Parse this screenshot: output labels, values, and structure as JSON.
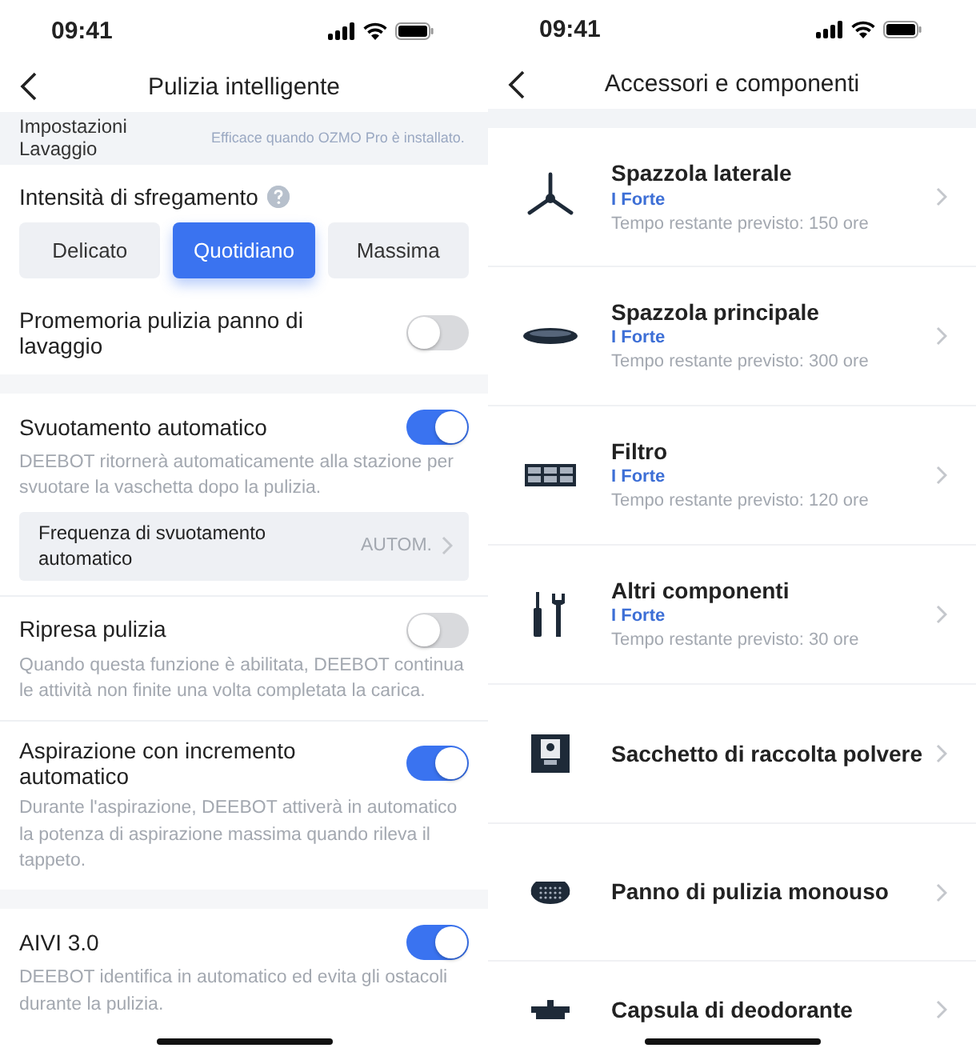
{
  "left_screen": {
    "status_bar": {
      "time": "09:41"
    },
    "title": "Pulizia intelligente",
    "mop_settings": {
      "label": "Impostazioni Lavaggio",
      "note": "Efficace quando OZMO Pro è installato."
    },
    "scrub_intensity": {
      "label": "Intensità di sfregamento",
      "options": [
        {
          "label": "Delicato",
          "selected": false
        },
        {
          "label": "Quotidiano",
          "selected": true
        },
        {
          "label": "Massima",
          "selected": false
        }
      ]
    },
    "setting_groups": [
      [
        {
          "title": "Promemoria pulizia panno di lavaggio",
          "on": false
        }
      ],
      [
        {
          "title": "Svuotamento automatico",
          "on": true,
          "description": "DEEBOT ritornerà automaticamente alla stazione per svuotare la vaschetta dopo la pulizia.",
          "sub_option": {
            "label": "Frequenza di svuotamento automatico",
            "value": "AUTOM."
          }
        },
        {
          "title": "Ripresa pulizia",
          "on": false,
          "description": "Quando questa funzione è abilitata, DEEBOT continua le attività non finite una volta completata la carica."
        },
        {
          "title": "Aspirazione con incremento automatico",
          "on": true,
          "description": "Durante l'aspirazione, DEEBOT attiverà in automatico la potenza di aspirazione massima quando rileva il tappeto."
        }
      ],
      [
        {
          "title": "AIVI 3.0",
          "on": true,
          "description": "DEEBOT identifica in automatico ed evita gli ostacoli durante la pulizia."
        }
      ]
    ]
  },
  "right_screen": {
    "status_bar": {
      "time": "09:41"
    },
    "title": "Accessori e componenti",
    "components": [
      {
        "kind": "side-brush",
        "name": "Spazzola laterale",
        "brand": "I Forte",
        "remaining": "Tempo restante previsto: 150 ore"
      },
      {
        "kind": "main-brush",
        "name": "Spazzola principale",
        "brand": "I Forte",
        "remaining": "Tempo restante previsto: 300 ore"
      },
      {
        "kind": "filter",
        "name": "Filtro",
        "brand": "I Forte",
        "remaining": "Tempo restante previsto: 120 ore"
      },
      {
        "kind": "tools",
        "name": "Altri componenti",
        "brand": "I Forte",
        "remaining": "Tempo restante previsto: 30 ore"
      },
      {
        "kind": "dust-bag",
        "name": "Sacchetto di raccolta polvere"
      },
      {
        "kind": "mop-pad",
        "name": "Panno di pulizia monouso"
      },
      {
        "kind": "capsule",
        "name": "Capsula di deodorante"
      }
    ]
  }
}
